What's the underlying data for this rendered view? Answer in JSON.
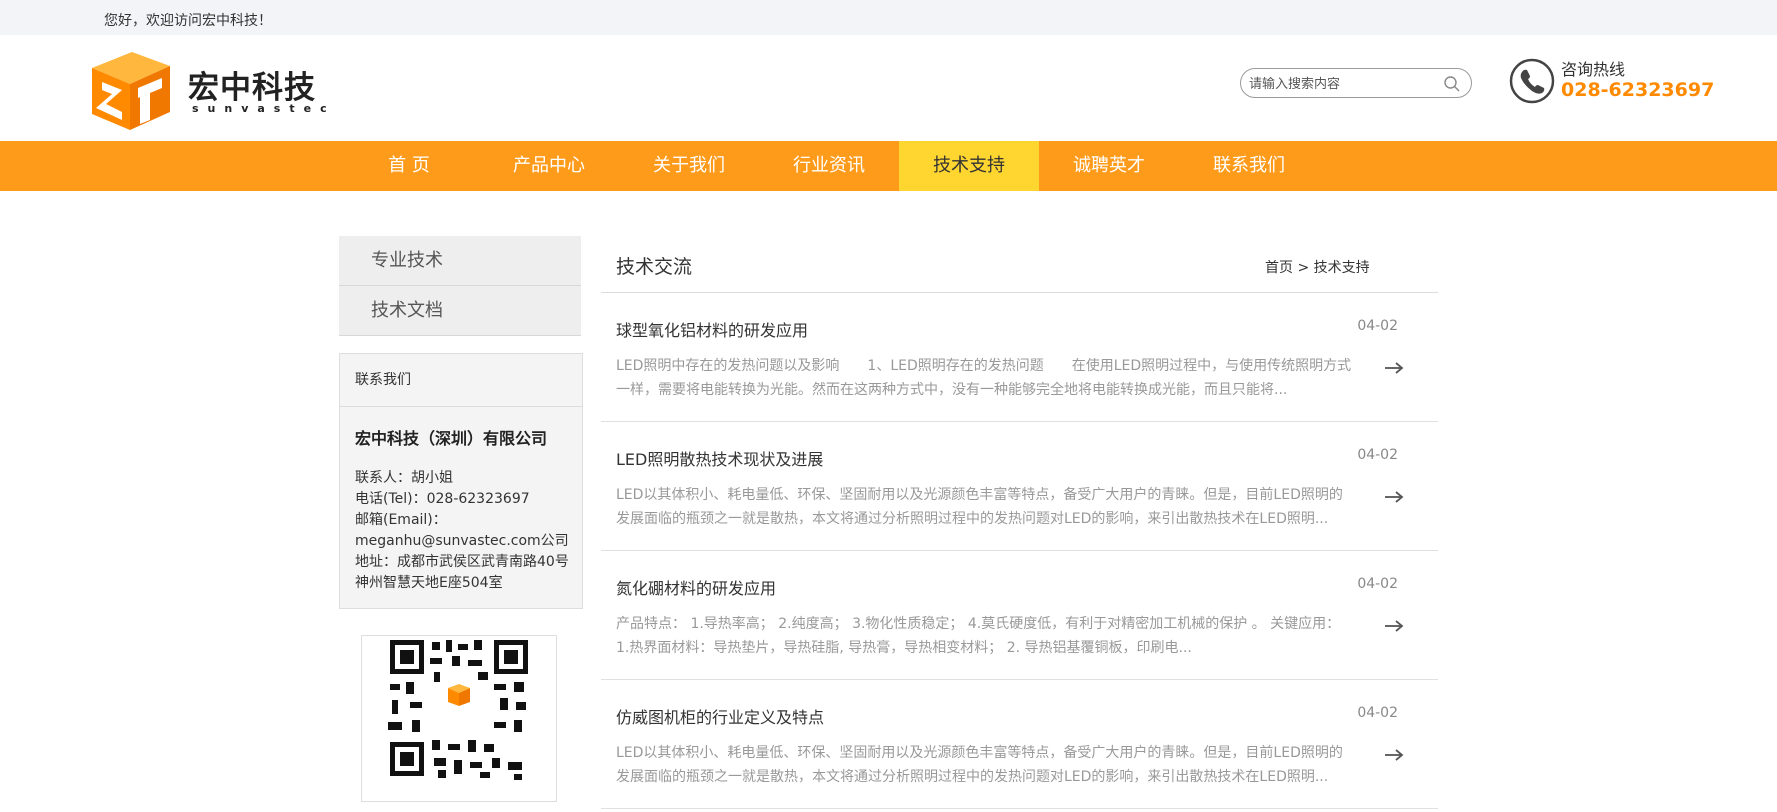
{
  "topbar": {
    "welcome": "您好，欢迎访问宏中科技！"
  },
  "header": {
    "brand_name": "宏中科技",
    "brand_sub": "sunvastec",
    "search_placeholder": "请输入搜索内容",
    "hotline_label": "咨询热线",
    "hotline_number": "028-62323697"
  },
  "nav": {
    "items": [
      {
        "label": "首 页"
      },
      {
        "label": "产品中心"
      },
      {
        "label": "关于我们"
      },
      {
        "label": "行业资讯"
      },
      {
        "label": "技术支持"
      },
      {
        "label": "诚聘英才"
      },
      {
        "label": "联系我们"
      }
    ],
    "active_index": 4
  },
  "sidebar": {
    "items": [
      {
        "label": "专业技术"
      },
      {
        "label": "技术文档"
      }
    ],
    "contact": {
      "heading": "联系我们",
      "company": "宏中科技（深圳）有限公司",
      "lines": [
        "联系人：胡小姐",
        "电话(Tel)：028-62323697",
        "邮箱(Email)：",
        "meganhu@sunvastec.com公司",
        "地址：成都市武侯区武青南路40号",
        "神州智慧天地E座504室"
      ]
    }
  },
  "main": {
    "title": "技术交流",
    "breadcrumb": {
      "home": "首页",
      "sep": ">",
      "current": "技术支持"
    },
    "articles": [
      {
        "title": "球型氧化铝材料的研发应用",
        "date": "04-02",
        "summary": "LED照明中存在的发热问题以及影响　　1、LED照明存在的发热问题　　在使用LED照明过程中，与使用传统照明方式一样，需要将电能转换为光能。然而在这两种方式中，没有一种能够完全地将电能转换成光能，而且只能将..."
      },
      {
        "title": "LED照明散热技术现状及进展",
        "date": "04-02",
        "summary": "LED以其体积小、耗电量低、环保、坚固耐用以及光源颜色丰富等特点，备受广大用户的青睐。但是，目前LED照明的发展面临的瓶颈之一就是散热，本文将通过分析照明过程中的发热问题对LED的影响，来引出散热技术在LED照明..."
      },
      {
        "title": "氮化硼材料的研发应用",
        "date": "04-02",
        "summary": "产品特点： 1.导热率高； 2.纯度高； 3.物化性质稳定； 4.莫氏硬度低，有利于对精密加工机械的保护 。 关键应用： 1.热界面材料：导热垫片，导热硅脂, 导热膏，导热相变材料； 2. 导热铝基覆铜板，印刷电..."
      },
      {
        "title": "仿威图机柜的行业定义及特点",
        "date": "04-02",
        "summary": "LED以其体积小、耗电量低、环保、坚固耐用以及光源颜色丰富等特点，备受广大用户的青睐。但是，目前LED照明的发展面临的瓶颈之一就是散热，本文将通过分析照明过程中的发热问题对LED的影响，来引出散热技术在LED照明..."
      }
    ]
  },
  "colors": {
    "accent": "#ff9b1a",
    "nav_active": "#ffd530",
    "hotline": "#ff8a00"
  }
}
